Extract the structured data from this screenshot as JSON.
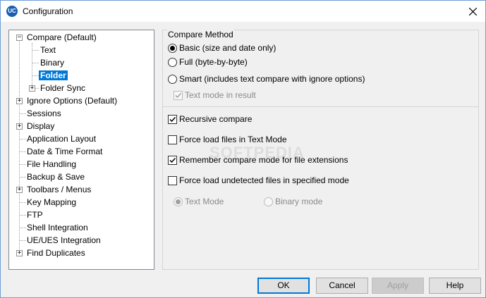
{
  "window": {
    "title": "Configuration",
    "app_icon_text": "UC",
    "close_icon": "close-icon"
  },
  "tree": {
    "items": [
      {
        "label": "Compare (Default)",
        "expander": "−"
      },
      {
        "label": "Text"
      },
      {
        "label": "Binary"
      },
      {
        "label": "Folder",
        "selected": true
      },
      {
        "label": "Folder Sync",
        "expander": "+"
      },
      {
        "label": "Ignore Options (Default)",
        "expander": "+"
      },
      {
        "label": "Sessions"
      },
      {
        "label": "Display",
        "expander": "+"
      },
      {
        "label": "Application Layout"
      },
      {
        "label": "Date & Time Format"
      },
      {
        "label": "File Handling"
      },
      {
        "label": "Backup & Save"
      },
      {
        "label": "Toolbars / Menus",
        "expander": "+"
      },
      {
        "label": "Key Mapping"
      },
      {
        "label": "FTP"
      },
      {
        "label": "Shell Integration"
      },
      {
        "label": "UE/UES Integration"
      },
      {
        "label": "Find Duplicates",
        "expander": "+"
      }
    ]
  },
  "compare_method": {
    "group_label": "Compare Method",
    "options": [
      {
        "label": "Basic (size and date only)",
        "checked": true
      },
      {
        "label": "Full  (byte-by-byte)",
        "checked": false
      },
      {
        "label": "Smart (includes text compare with ignore options)",
        "checked": false
      }
    ],
    "text_mode_result": {
      "label": "Text mode in result",
      "checked": true,
      "disabled": true
    }
  },
  "options": {
    "recursive_compare": {
      "label": "Recursive compare",
      "checked": true
    },
    "force_text_mode": {
      "label": "Force load files in Text Mode",
      "checked": false
    },
    "remember_mode": {
      "label": "Remember compare mode for file extensions",
      "checked": true
    },
    "force_undetected": {
      "label": "Force load undetected files in specified mode",
      "checked": false
    }
  },
  "mode_select": {
    "text_mode": {
      "label": "Text Mode",
      "checked": true,
      "disabled": true
    },
    "binary_mode": {
      "label": "Binary mode",
      "checked": false,
      "disabled": true
    }
  },
  "buttons": {
    "ok": "OK",
    "cancel": "Cancel",
    "apply": "Apply",
    "help": "Help"
  },
  "watermark": "SOFTPEDIA"
}
